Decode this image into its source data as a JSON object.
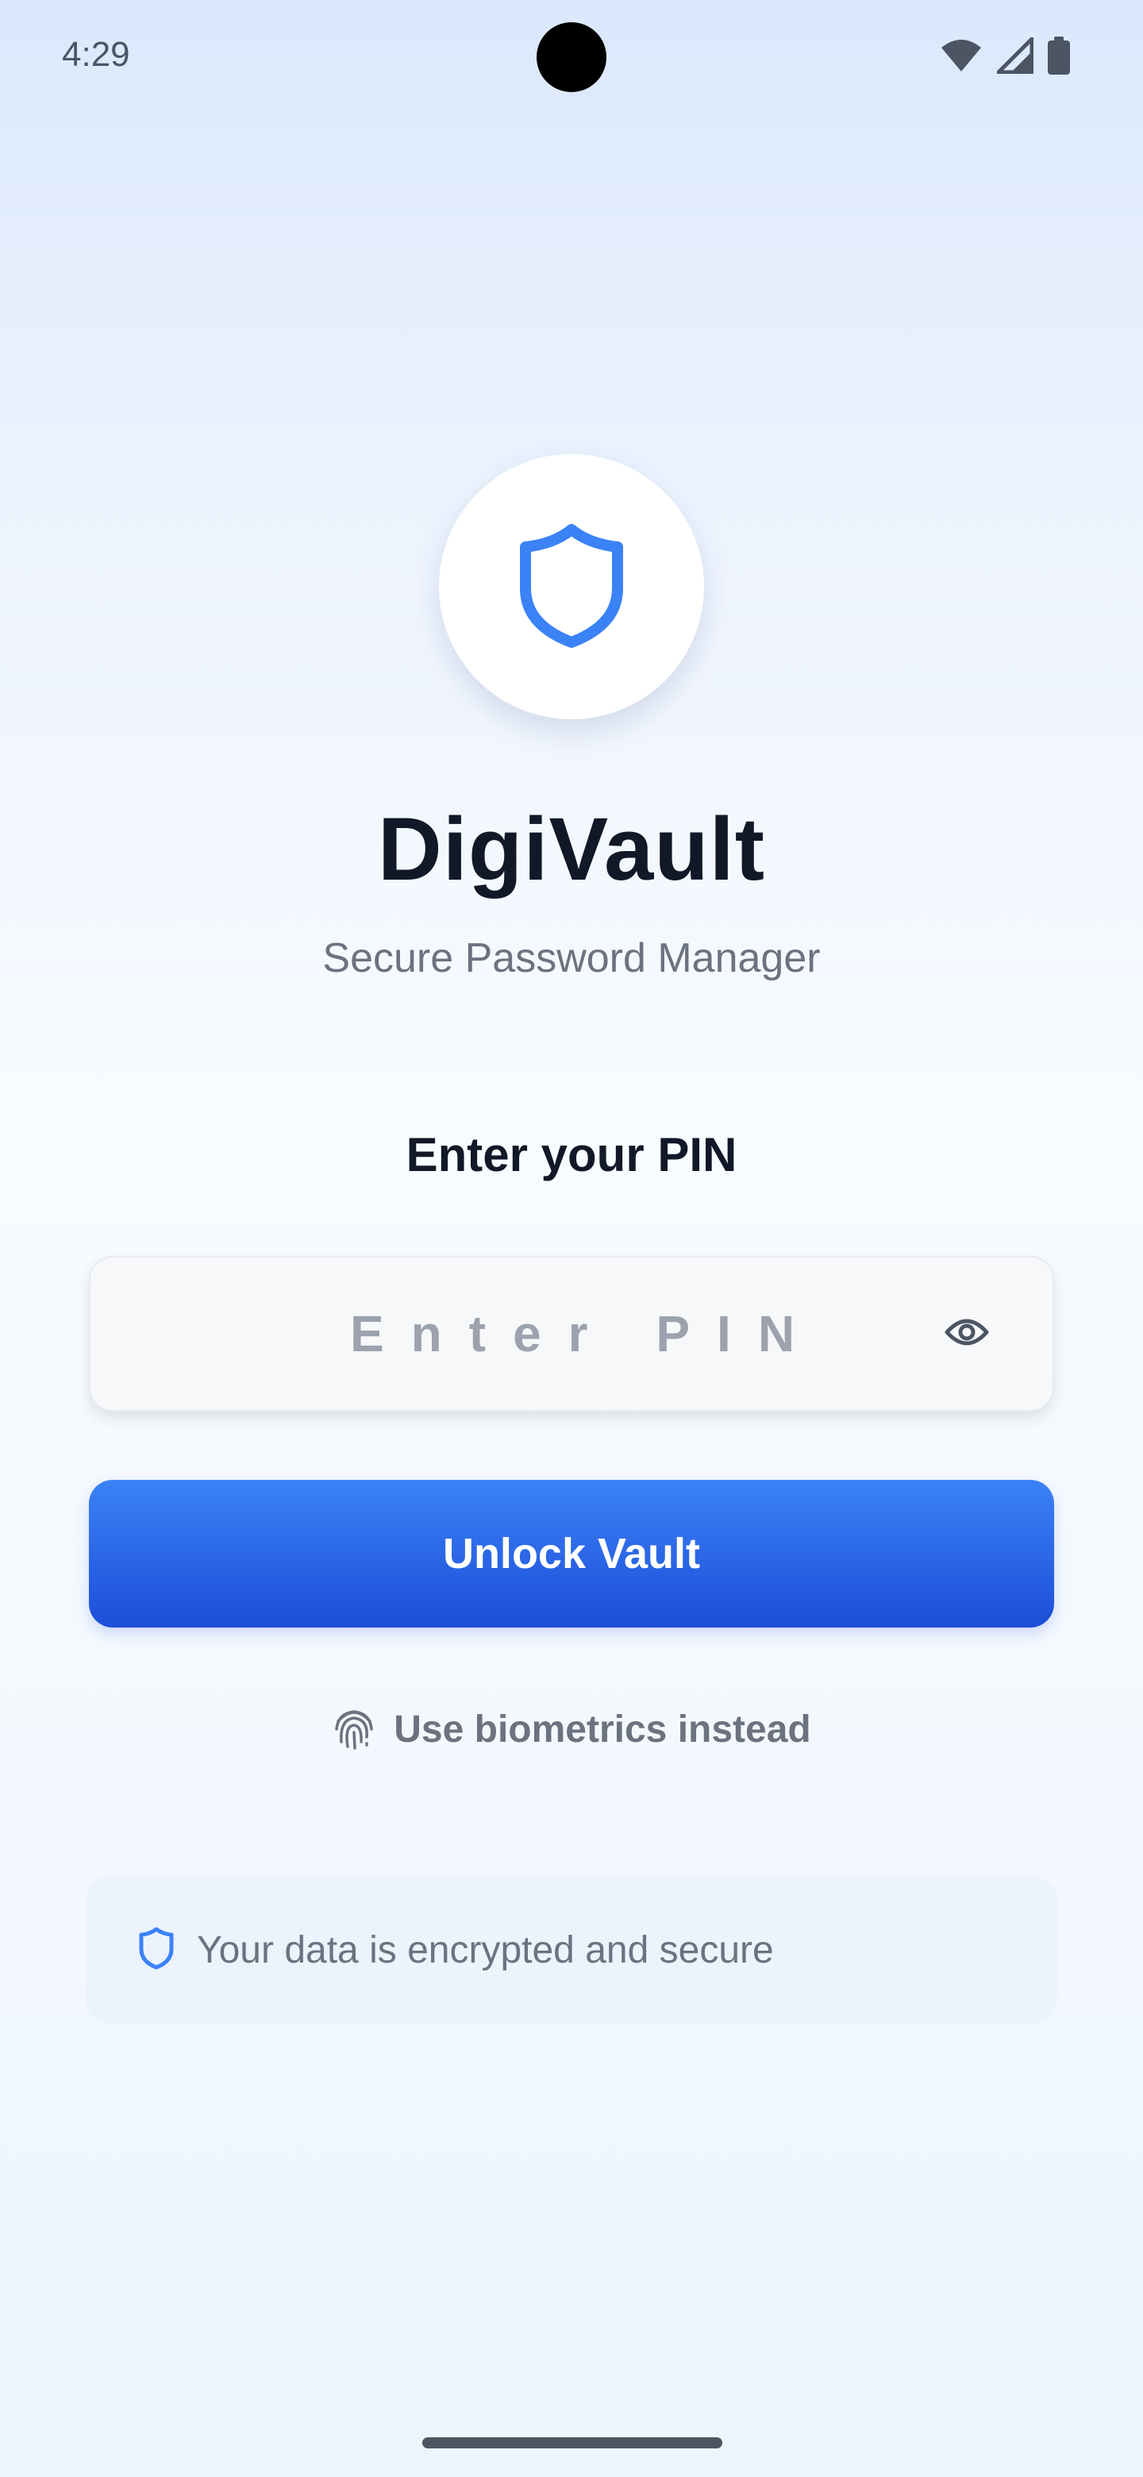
{
  "status_bar": {
    "time": "4:29",
    "icons": [
      "wifi-icon",
      "cellular-signal-icon",
      "battery-icon"
    ]
  },
  "app": {
    "logo_icon": "shield-icon",
    "title": "DigiVault",
    "subtitle": "Secure Password Manager"
  },
  "pin": {
    "heading": "Enter your PIN",
    "placeholder": "Enter PIN",
    "value": "",
    "toggle_icon": "eye-icon"
  },
  "actions": {
    "unlock_label": "Unlock Vault",
    "biometric_label": "Use biometrics instead",
    "biometric_icon": "fingerprint-icon"
  },
  "security_note": {
    "icon": "shield-icon",
    "text": "Your data is encrypted and secure"
  },
  "colors": {
    "accent": "#3b82f6",
    "accent_dark": "#1d4ed8",
    "title_text": "#111827",
    "muted_text": "#6b7280",
    "placeholder_text": "#9ca3af"
  }
}
